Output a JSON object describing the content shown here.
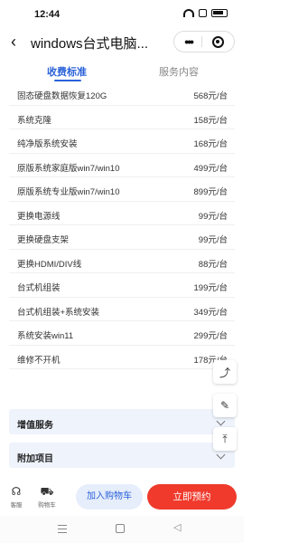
{
  "status_bar": {
    "time": "12:44"
  },
  "header": {
    "title": "windows台式电脑...",
    "back_icon": "chevron-left-icon",
    "more_icon": "more-dots-icon",
    "target_icon": "target-icon"
  },
  "tabs": [
    {
      "label": "收费标准",
      "active": true
    },
    {
      "label": "服务内容",
      "active": false
    }
  ],
  "price_list": [
    {
      "name": "固态硬盘数据恢复120G",
      "price": "568元/台"
    },
    {
      "name": "系统克隆",
      "price": "158元/台"
    },
    {
      "name": "纯净版系统安装",
      "price": "168元/台"
    },
    {
      "name": "原版系统家庭版win7/win10",
      "price": "499元/台"
    },
    {
      "name": "原版系统专业版win7/win10",
      "price": "899元/台"
    },
    {
      "name": "更换电源线",
      "price": "99元/台"
    },
    {
      "name": "更换硬盘支架",
      "price": "99元/台"
    },
    {
      "name": "更换HDMI/DIV线",
      "price": "88元/台"
    },
    {
      "name": "台式机组装",
      "price": "199元/台"
    },
    {
      "name": "台式机组装+系统安装",
      "price": "349元/台"
    },
    {
      "name": "系统安装win11",
      "price": "299元/台"
    },
    {
      "name": "维修不开机",
      "price": "178元/台"
    }
  ],
  "sections": [
    {
      "label": "增值服务"
    },
    {
      "label": "附加项目"
    }
  ],
  "floating_buttons": [
    "share-icon",
    "edit-note-icon",
    "back-to-top-icon"
  ],
  "bottom_bar": {
    "service_label": "客服",
    "cart_label": "购物车",
    "add_to_cart": "加入购物车",
    "book_now": "立即预约"
  },
  "colors": {
    "accent": "#2b63d9",
    "cta": "#ef3a2c",
    "section_bg": "#eef3fc"
  }
}
